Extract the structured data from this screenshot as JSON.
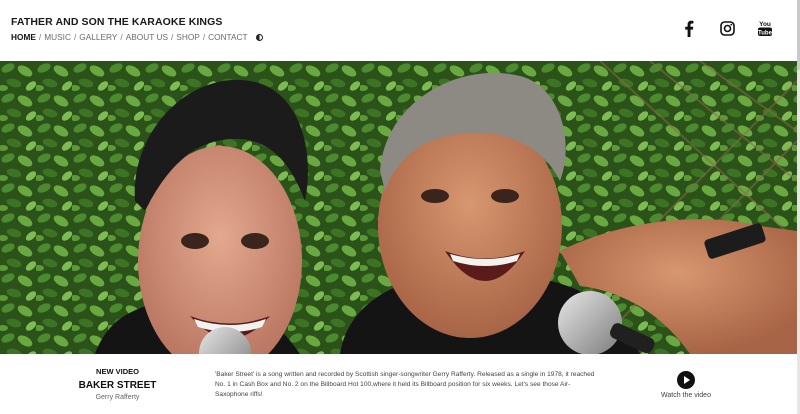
{
  "header": {
    "site_title": "FATHER AND SON THE KARAOKE KINGS",
    "nav": [
      {
        "label": "HOME"
      },
      {
        "label": "MUSIC"
      },
      {
        "label": "GALLERY"
      },
      {
        "label": "ABOUT US"
      },
      {
        "label": "SHOP"
      },
      {
        "label": "CONTACT"
      }
    ],
    "separator": "/",
    "theme_toggle_icon": "contrast-half-circle-icon",
    "social": [
      {
        "icon": "facebook-icon"
      },
      {
        "icon": "instagram-icon"
      },
      {
        "icon": "youtube-icon",
        "text": "You Tube"
      }
    ]
  },
  "hero": {
    "image": "photo of two men singing into microphones in front of a green hedge",
    "icon": "hero-photo"
  },
  "featured": {
    "kicker": "NEW VIDEO",
    "song_title": "BAKER STREET",
    "artist": "Gerry Rafferty",
    "description": "'Baker Street' is a song written and recorded by Scottish singer-songwriter Gerry Rafferty. Released as a single in 1978, it reached No. 1 in Cash Box and No. 2 on the Billboard Hot 100,where it held its Billboard position for six weeks. Let's see those Air-Saxophone riffs!",
    "watch_label": "Watch the video",
    "play_icon": "play-circle-icon"
  },
  "colors": {
    "text_dark": "#111111",
    "nav_gray": "#6b6b6b",
    "hedge_green": "#2f5a1d"
  }
}
